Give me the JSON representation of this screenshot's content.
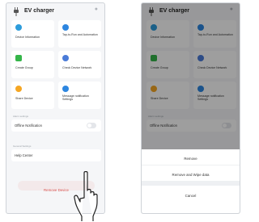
{
  "app": {
    "title": "EV charger",
    "more_icon": "more-dots-icon",
    "accent": "#1a9cf0"
  },
  "cards": [
    {
      "label": "Device Information",
      "icon": "info-icon",
      "color": "#2d9cdb"
    },
    {
      "label": "Tap-to-Run and Automation",
      "icon": "automation-icon",
      "color": "#2d86e0"
    },
    {
      "label": "Create Group",
      "icon": "group-icon",
      "color": "#35b54a"
    },
    {
      "label": "Check Device Network",
      "icon": "network-icon",
      "color": "#4a7bd8"
    },
    {
      "label": "Share Device",
      "icon": "share-icon",
      "color": "#f5a623"
    },
    {
      "label": "Message notification Settings",
      "icon": "bell-icon",
      "color": "#2d86e0"
    }
  ],
  "settings": {
    "section_label": "Alarm settings",
    "offline_label": "Offline Notification",
    "offline_enabled": false
  },
  "general": {
    "section_label": "General Settings",
    "help_label": "Help Center"
  },
  "remove_button": {
    "label": "Remove Device",
    "color": "#d9534f"
  },
  "action_sheet": {
    "options": [
      "Remove",
      "Remove and Wipe data"
    ],
    "cancel": "Cancel"
  }
}
